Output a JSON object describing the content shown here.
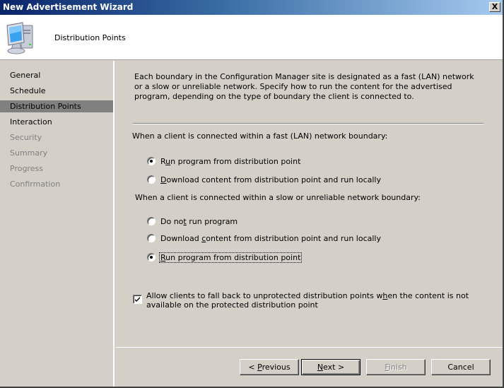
{
  "window": {
    "title": "New Advertisement Wizard",
    "close_label": "X"
  },
  "header": {
    "icon": "computer-icon",
    "title": "Distribution Points"
  },
  "sidebar": {
    "items": [
      {
        "label": "General",
        "state": "enabled"
      },
      {
        "label": "Schedule",
        "state": "enabled"
      },
      {
        "label": "Distribution Points",
        "state": "active"
      },
      {
        "label": "Interaction",
        "state": "enabled"
      },
      {
        "label": "Security",
        "state": "disabled"
      },
      {
        "label": "Summary",
        "state": "disabled"
      },
      {
        "label": "Progress",
        "state": "disabled"
      },
      {
        "label": "Confirmation",
        "state": "disabled"
      }
    ]
  },
  "main": {
    "intro": "Each boundary in the Configuration Manager site is designated as a fast (LAN) network or a slow or unreliable network. Specify how to run the content for the advertised program, depending on the type of boundary the client is connected to.",
    "fast_group": {
      "label": "When a client is connected within a fast (LAN) network boundary:",
      "options": [
        {
          "pre": "R",
          "accel": "u",
          "post": "n program from distribution point",
          "checked": true
        },
        {
          "pre": "",
          "accel": "D",
          "post": "ownload content from distribution point and run locally",
          "checked": false
        }
      ]
    },
    "slow_group": {
      "label": "When a client is connected within a slow or unreliable network boundary:",
      "options": [
        {
          "pre": "Do no",
          "accel": "t",
          "post": " run program",
          "checked": false
        },
        {
          "pre": "Download ",
          "accel": "c",
          "post": "ontent from distribution point and run locally",
          "checked": false
        },
        {
          "pre": "",
          "accel": "R",
          "post": "un program from distribution point",
          "checked": true
        }
      ]
    },
    "fallback": {
      "pre": "Allow clients to fall back to unprotected distribution points w",
      "accel": "h",
      "post": "en the content is not available on the protected distribution point",
      "checked": true
    }
  },
  "buttons": {
    "previous": {
      "pre": "< ",
      "accel": "P",
      "post": "revious"
    },
    "next": {
      "pre": "",
      "accel": "N",
      "post": "ext >"
    },
    "finish": {
      "pre": "",
      "accel": "F",
      "post": "inish"
    },
    "cancel": {
      "label": "Cancel"
    }
  }
}
